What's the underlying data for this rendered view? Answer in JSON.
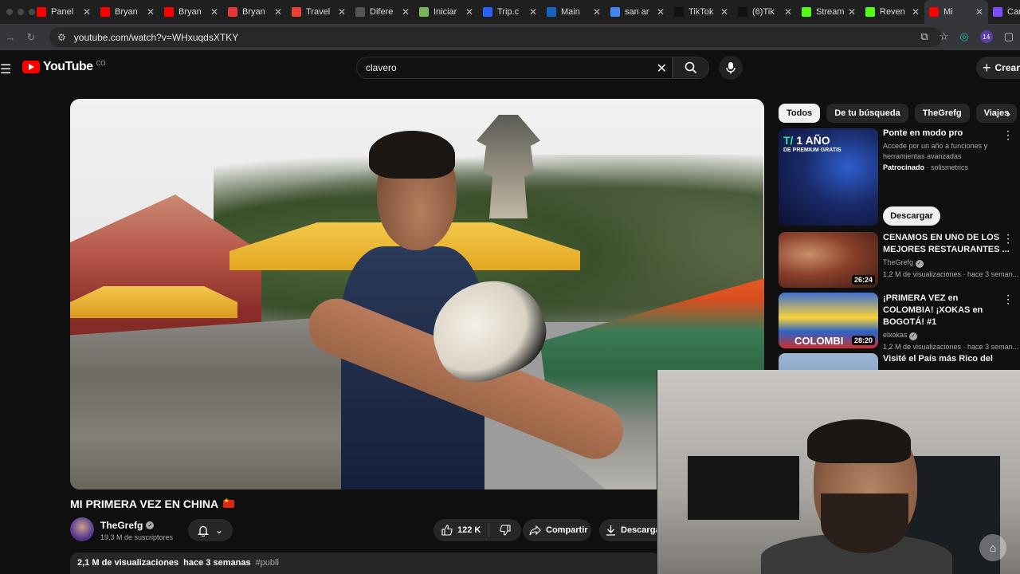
{
  "browser": {
    "tabs": [
      {
        "title": "Panel",
        "fav": "youtube-icon",
        "color": "#ff0000"
      },
      {
        "title": "Bryan",
        "fav": "youtube-icon",
        "color": "#ff0000"
      },
      {
        "title": "Bryan",
        "fav": "youtube-icon",
        "color": "#ff0000"
      },
      {
        "title": "Bryan",
        "fav": "analytics-icon",
        "color": "#e53935"
      },
      {
        "title": "Travel",
        "fav": "g-icon",
        "color": "#ea4335"
      },
      {
        "title": "Difere",
        "fav": "openai-icon",
        "color": "#555555"
      },
      {
        "title": "Iniciar",
        "fav": "shopify-icon",
        "color": "#7ab55c"
      },
      {
        "title": "Trip.c",
        "fav": "t-icon",
        "color": "#2962ff"
      },
      {
        "title": "Main",
        "fav": "paw-icon",
        "color": "#1565c0"
      },
      {
        "title": "san ar",
        "fav": "google-icon",
        "color": "#4285f4"
      },
      {
        "title": "TikTok",
        "fav": "tiktok-icon",
        "color": "#111111"
      },
      {
        "title": "(6)Tik",
        "fav": "tiktok-icon",
        "color": "#111111"
      },
      {
        "title": "Stream",
        "fav": "k-icon",
        "color": "#53fc18"
      },
      {
        "title": "Reven",
        "fav": "k-icon",
        "color": "#53fc18"
      },
      {
        "title": "Mi",
        "fav": "youtube-icon",
        "color": "#ff0000",
        "active": true
      },
      {
        "title": "Cam",
        "fav": "circle-icon",
        "color": "#7c4dff"
      }
    ],
    "url": "youtube.com/watch?v=WHxuqdsXTKY",
    "extension_badge": "14"
  },
  "header": {
    "logo_text": "YouTube",
    "country_code": "CO",
    "search_value": "clavero",
    "create_label": "Crear"
  },
  "video": {
    "title": "MI PRIMERA VEZ EN CHINA",
    "channel": "TheGrefg",
    "subscribers": "19,3 M de suscriptores",
    "likes": "122 K",
    "share_label": "Compartir",
    "download_label": "Descargar",
    "views": "2,1 M de visualizaciones",
    "published": "hace 3 semanas",
    "hashtag": "#publi"
  },
  "sidebar": {
    "chips": [
      {
        "label": "Todos",
        "active": true
      },
      {
        "label": "De tu búsqueda"
      },
      {
        "label": "TheGrefg"
      },
      {
        "label": "Viajes"
      }
    ],
    "ad": {
      "title": "Ponte en modo pro",
      "description": "Accede por un año a funciones y herramientas avanzadas",
      "sponsored": "Patrocinado",
      "advertiser": "solismetrics",
      "cta": "Descargar",
      "thumb_big_1": "1 AÑO",
      "thumb_big_prefix": "T/",
      "thumb_small": "DE PREMIUM GRATIS"
    },
    "recommendations": [
      {
        "title": "CENAMOS EN UNO DE LOS MEJORES RESTAURANTES ...",
        "channel": "TheGrefg",
        "meta": "1,2 M de visualizaciones · hace 3 seman...",
        "duration": "26:24"
      },
      {
        "title": "¡PRIMERA VEZ en COLOMBIA! ¡XOKAS en BOGOTÁ! #1",
        "channel": "elxokas",
        "meta": "1,2 M de visualizaciones · hace 3 seman...",
        "duration": "28:20",
        "thumb_text": "COLOMBI"
      },
      {
        "title": "Visité el País más Rico del",
        "channel": "",
        "meta": "",
        "duration": ""
      }
    ]
  }
}
